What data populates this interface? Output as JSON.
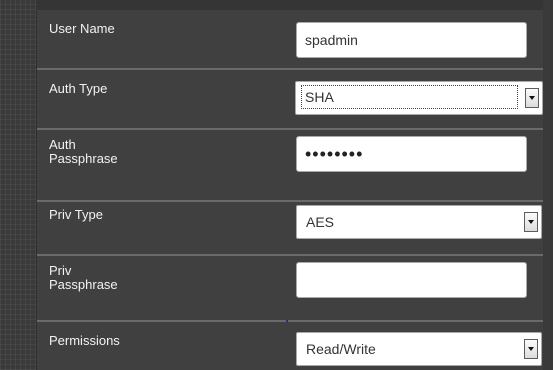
{
  "form": {
    "user_name": {
      "label": "User Name",
      "value": "spadmin"
    },
    "auth_type": {
      "label": "Auth Type",
      "value": "SHA"
    },
    "auth_passphrase": {
      "label": "Auth\nPassphrase",
      "value": "••••••••"
    },
    "priv_type": {
      "label": "Priv Type",
      "value": "AES"
    },
    "priv_passphrase": {
      "label": "Priv\nPassphrase",
      "value": ""
    },
    "permissions": {
      "label": "Permissions",
      "value": "Read/Write"
    }
  },
  "icons": {
    "dropdown": "chevron-down-icon"
  },
  "colors": {
    "panel_background": "#404040",
    "row_divider": "#6a6a6a",
    "label_text": "#f2f2f2",
    "input_background": "#ffffff"
  }
}
